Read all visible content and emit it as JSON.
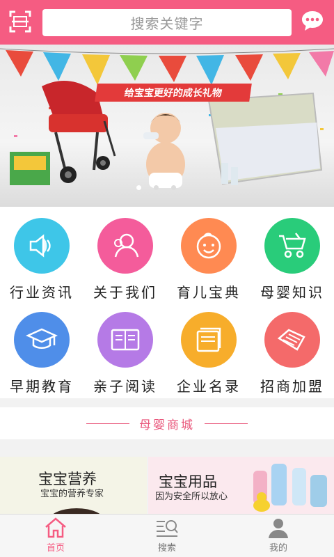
{
  "header": {
    "search_placeholder": "搜索关键字",
    "scan_icon": "scan-icon",
    "chat_icon": "chat-icon"
  },
  "banner": {
    "slogan": "给宝宝更好的成长礼物",
    "page_count": 3
  },
  "grid": [
    {
      "label": "行业资讯",
      "icon": "speaker-icon",
      "color": "#3ec6e8"
    },
    {
      "label": "关于我们",
      "icon": "people-icon",
      "color": "#f45c9b"
    },
    {
      "label": "育儿宝典",
      "icon": "baby-face-icon",
      "color": "#ff8a52"
    },
    {
      "label": "母婴知识",
      "icon": "stroller-icon",
      "color": "#29cc7a"
    },
    {
      "label": "早期教育",
      "icon": "graduation-cap-icon",
      "color": "#4f8ee9"
    },
    {
      "label": "亲子阅读",
      "icon": "book-icon",
      "color": "#b57ae6"
    },
    {
      "label": "企业名录",
      "icon": "folder-icon",
      "color": "#f7ad2b"
    },
    {
      "label": "招商加盟",
      "icon": "handshake-icon",
      "color": "#f46a6a"
    }
  ],
  "section": {
    "title": "母婴商城"
  },
  "cards": [
    {
      "title": "宝宝营养",
      "subtitle": "宝宝的营养专家"
    },
    {
      "title": "宝宝用品",
      "subtitle": "因为安全所以放心"
    }
  ],
  "tabbar": [
    {
      "label": "首页",
      "icon": "home-icon",
      "active": true
    },
    {
      "label": "搜索",
      "icon": "search-icon",
      "active": false
    },
    {
      "label": "我的",
      "icon": "user-icon",
      "active": false
    }
  ],
  "colors": {
    "brand": "#f55c82",
    "accent": "#e9577b"
  }
}
